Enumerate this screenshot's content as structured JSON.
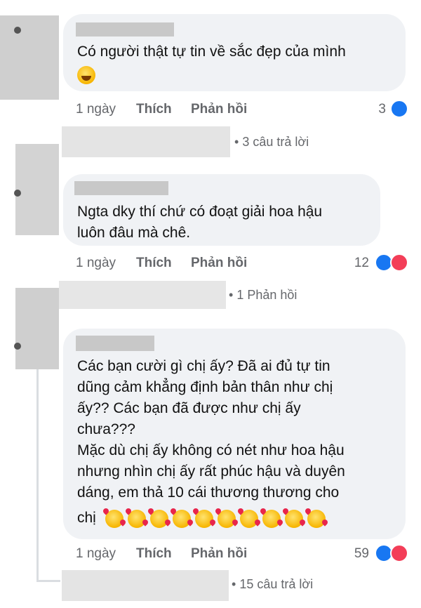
{
  "comments": [
    {
      "text_lines": [
        "Có người thật tự tin về sắc đẹp của mình"
      ],
      "emoji": "face-with-tears-of-joy",
      "time": "1 ngày",
      "like_label": "Thích",
      "reply_label": "Phản hồi",
      "reaction_count": "3",
      "reactions": [
        "like"
      ],
      "replies_text": "3 câu trả lời"
    },
    {
      "text_lines": [
        "Ngta dky thí chứ có đoạt giải hoa hậu",
        "luôn đâu mà chê."
      ],
      "time": "1 ngày",
      "like_label": "Thích",
      "reply_label": "Phản hồi",
      "reaction_count": "12",
      "reactions": [
        "like",
        "love"
      ],
      "replies_text": "1 Phản hồi"
    },
    {
      "text_lines": [
        "Các bạn cười gì chị ấy? Đã ai đủ tự tin",
        "dũng cảm khẳng định bản thân như chị",
        "ấy?? Các bạn đã được như chị ấy",
        "chưa???",
        "Mặc dù chị ấy không có nét như hoa hậu",
        "nhưng nhìn chị ấy rất phúc hậu và duyên",
        "dáng, em thả 10 cái thương thương cho",
        "chị"
      ],
      "emoji_count": 10,
      "emoji": "smiling-face-with-hearts",
      "time": "1 ngày",
      "like_label": "Thích",
      "reply_label": "Phản hồi",
      "reaction_count": "59",
      "reactions": [
        "like",
        "love"
      ],
      "replies_text": "15 câu trả lời"
    }
  ],
  "colors": {
    "bubble": "#f0f2f5",
    "meta": "#65676b",
    "like": "#1877f2",
    "love": "#f33e58"
  }
}
